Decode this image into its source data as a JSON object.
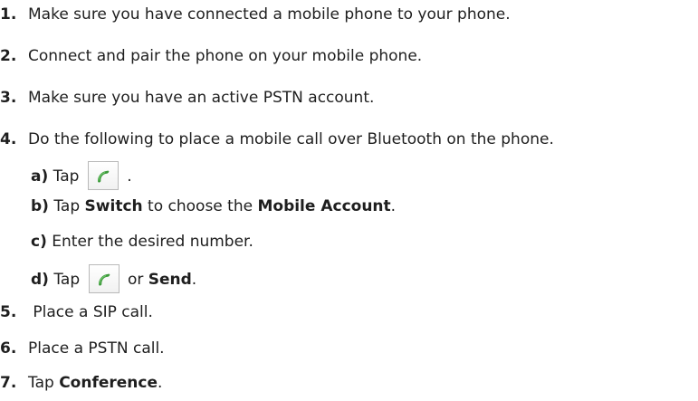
{
  "steps": [
    {
      "num": "1.",
      "text": "Make sure you have connected a mobile phone to your phone."
    },
    {
      "num": "2.",
      "text": "Connect and pair the phone on your mobile phone."
    },
    {
      "num": "3.",
      "text": "Make sure you have an active PSTN account."
    },
    {
      "num": "4.",
      "text": "Do the following to place a mobile call over Bluetooth on the phone."
    },
    {
      "num": "5.",
      "text": " Place a SIP call."
    },
    {
      "num": "6.",
      "text": "Place a PSTN call."
    },
    {
      "num": "7.",
      "pre": "Tap ",
      "bold": "Conference",
      "post": "."
    }
  ],
  "substeps": {
    "a": {
      "mark": "a)",
      "pre": " Tap ",
      "post": " ."
    },
    "b": {
      "mark": "b)",
      "pre": " Tap ",
      "bold1": "Switch",
      "mid": " to choose the ",
      "bold2": "Mobile Account",
      "post": "."
    },
    "c": {
      "mark": "c)",
      "text": " Enter the desired number."
    },
    "d": {
      "mark": "d)",
      "pre": " Tap ",
      "mid": " or ",
      "bold": "Send",
      "post": "."
    }
  },
  "icons": {
    "call_icon": "phone-handset-icon",
    "call_icon_color": "#3c9a3a"
  }
}
